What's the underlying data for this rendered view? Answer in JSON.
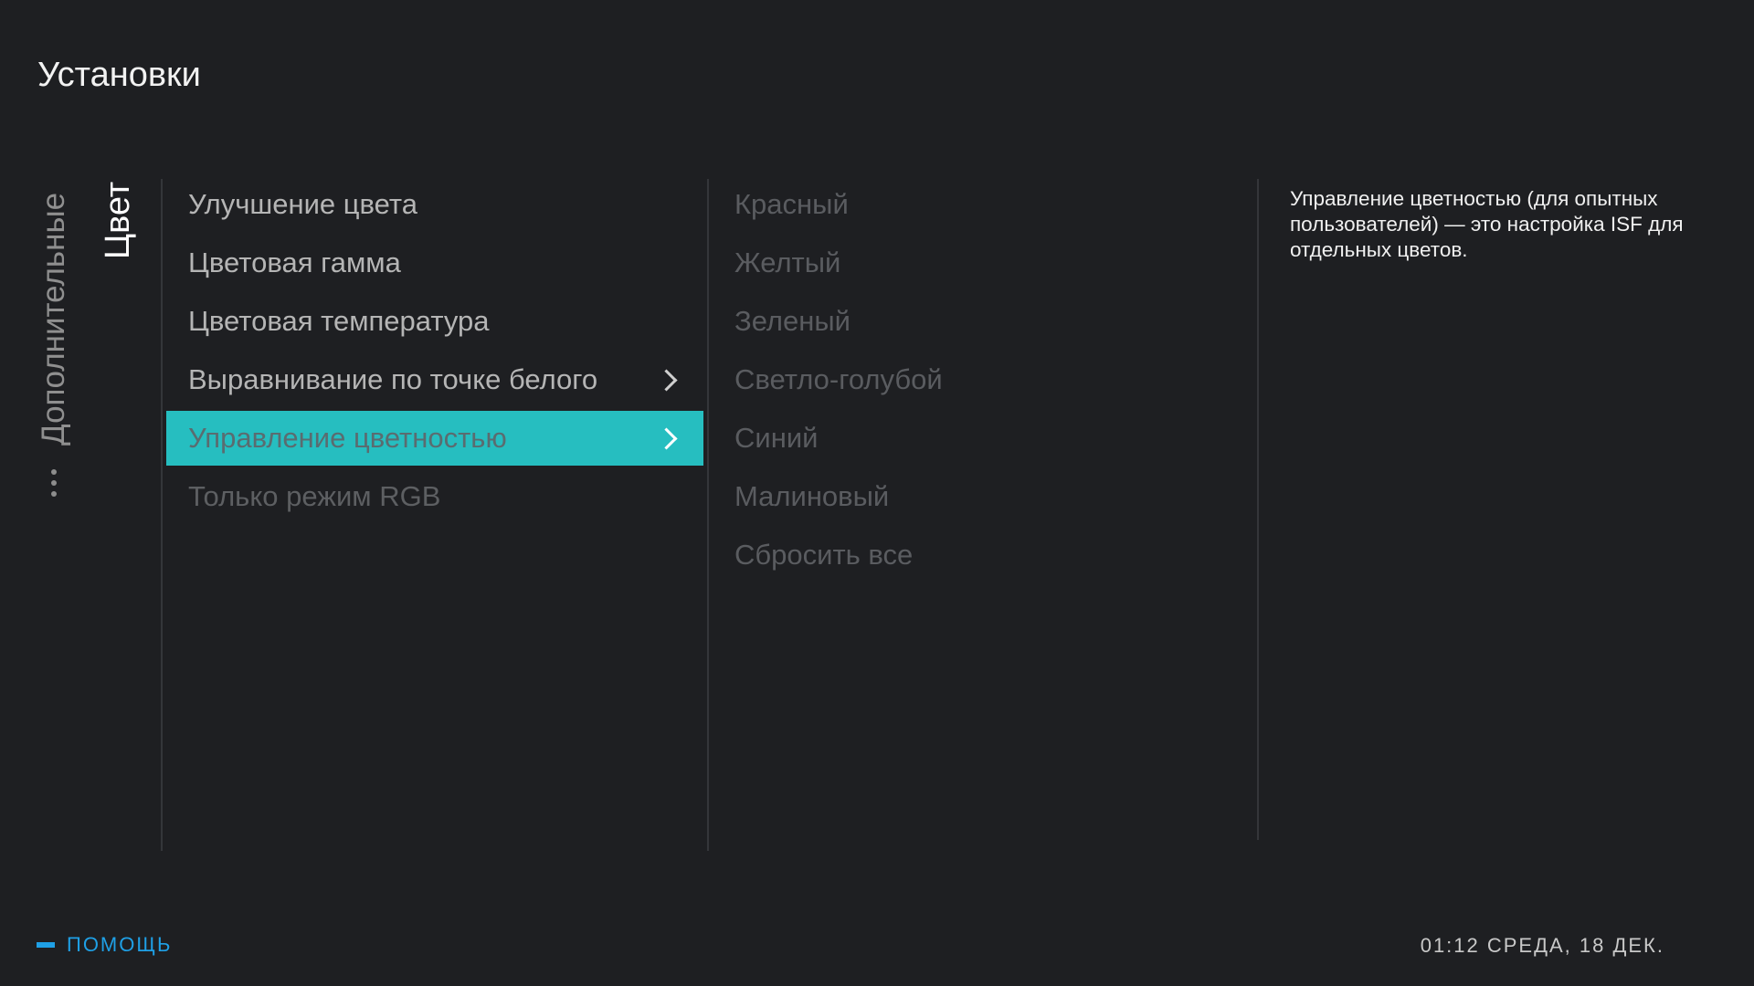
{
  "header": {
    "title": "Установки"
  },
  "breadcrumb": {
    "more_icon": "ellipsis-vertical-icon",
    "parent": "Дополнительные",
    "current": "Цвет"
  },
  "menu": {
    "items": [
      {
        "label": "Улучшение цвета",
        "state": "normal",
        "chevron": false
      },
      {
        "label": "Цветовая гамма",
        "state": "normal",
        "chevron": false
      },
      {
        "label": "Цветовая температура",
        "state": "normal",
        "chevron": false
      },
      {
        "label": "Выравнивание по точке белого",
        "state": "normal",
        "chevron": true
      },
      {
        "label": "Управление цветностью",
        "state": "selected",
        "chevron": true
      },
      {
        "label": "Только режим RGB",
        "state": "disabled",
        "chevron": false
      }
    ]
  },
  "submenu": {
    "items": [
      "Красный",
      "Желтый",
      "Зеленый",
      "Светло-голубой",
      "Синий",
      "Малиновый",
      "Сбросить все"
    ]
  },
  "help_text": "Управление цветностью (для опытных пользователей) — это настройка ISF для отдельных цветов.",
  "footer": {
    "help_label": "ПОМОЩЬ",
    "clock": "01:12 СРЕДА, 18 ДЕК."
  },
  "colors": {
    "background": "#1e1f22",
    "accent": "#26bec0",
    "help_blue": "#1fa0e6"
  }
}
